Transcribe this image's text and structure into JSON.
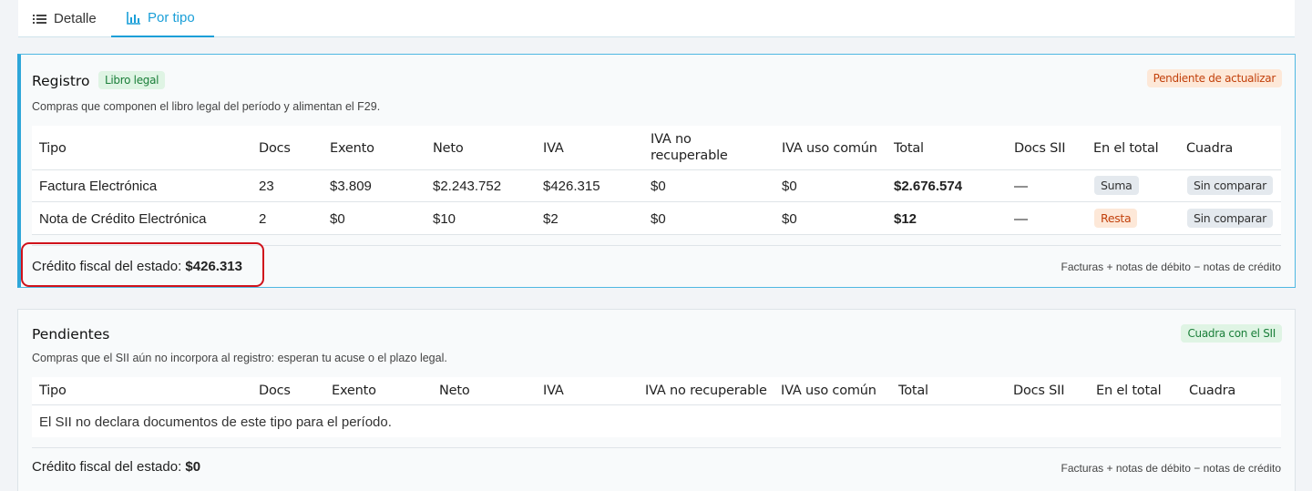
{
  "tabs": [
    {
      "label": "Detalle",
      "icon": "list-icon",
      "active": false
    },
    {
      "label": "Por tipo",
      "icon": "bar-chart-icon",
      "active": true
    }
  ],
  "registro": {
    "title": "Registro",
    "badge": "Libro legal",
    "status": "Pendiente de actualizar",
    "subtitle": "Compras que componen el libro legal del período y alimentan el F29.",
    "headers": [
      "Tipo",
      "Docs",
      "Exento",
      "Neto",
      "IVA",
      "IVA no recuperable",
      "IVA uso común",
      "Total",
      "Docs SII",
      "En el total",
      "Cuadra"
    ],
    "rows": [
      {
        "tipo": "Factura Electrónica",
        "docs": "23",
        "exento": "$3.809",
        "neto": "$2.243.752",
        "iva": "$426.315",
        "iva_no_rec": "$0",
        "iva_uso": "$0",
        "total": "$2.676.574",
        "docs_sii": "—",
        "en_total": "Suma",
        "cuadra": "Sin comparar"
      },
      {
        "tipo": "Nota de Crédito Electrónica",
        "docs": "2",
        "exento": "$0",
        "neto": "$10",
        "iva": "$2",
        "iva_no_rec": "$0",
        "iva_uso": "$0",
        "total": "$12",
        "docs_sii": "—",
        "en_total": "Resta",
        "cuadra": "Sin comparar"
      }
    ],
    "credit_label": "Crédito fiscal del estado: ",
    "credit_value": "$426.313",
    "formula": "Facturas + notas de débito − notas de crédito"
  },
  "pendientes": {
    "title": "Pendientes",
    "status": "Cuadra con el SII",
    "subtitle": "Compras que el SII aún no incorpora al registro: esperan tu acuse o el plazo legal.",
    "headers": [
      "Tipo",
      "Docs",
      "Exento",
      "Neto",
      "IVA",
      "IVA no recuperable",
      "IVA uso común",
      "Total",
      "Docs SII",
      "En el total",
      "Cuadra"
    ],
    "empty_message": "El SII no declara documentos de este tipo para el período.",
    "credit_label": "Crédito fiscal del estado: ",
    "credit_value": "$0",
    "formula": "Facturas + notas de débito − notas de crédito"
  },
  "colors": {
    "accent": "#1a9fd8",
    "highlight": "#d0121b",
    "success": "#1b7f3a",
    "warning": "#c2410c"
  }
}
